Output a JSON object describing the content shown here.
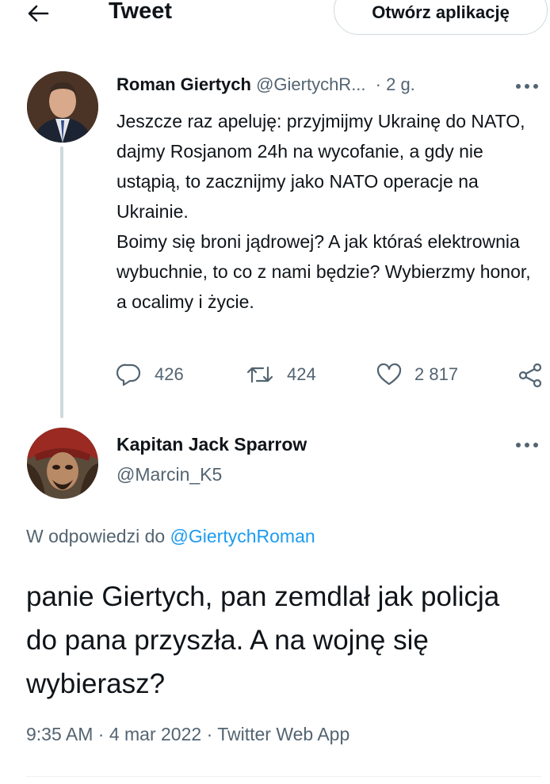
{
  "header": {
    "title": "Tweet",
    "open_app_label": "Otwórz aplikację"
  },
  "tweet": {
    "author_name": "Roman Giertych",
    "handle": "@GiertychR...",
    "time": "· 2 g.",
    "text": "Jeszcze raz apeluję: przyjmijmy Ukrainę do NATO, dajmy Rosjanom 24h na wycofanie, a gdy nie ustąpią, to zacznijmy jako NATO operacje na Ukrainie.\nBoimy się broni jądrowej? A jak któraś elektrownia wybuchnie, to co z nami będzie? Wybierzmy honor, a ocalimy i życie.",
    "actions": {
      "replies": "426",
      "retweets": "424",
      "likes": "2 817"
    }
  },
  "reply": {
    "author_name": "Kapitan Jack Sparrow",
    "handle": "@Marcin_K5",
    "in_reply_prefix": "W odpowiedzi do",
    "in_reply_handle": "@GiertychRoman",
    "text": "panie Giertych, pan zemdlał jak policja do pana przyszła. A na wojnę się wybierasz?",
    "timestamp": "9:35 AM · 4 mar 2022 · Twitter Web App"
  },
  "colors": {
    "text": "#0f1419",
    "secondary": "#536471",
    "link": "#1d9bf0",
    "border": "#cfd9de"
  },
  "icons": [
    "back-arrow-icon",
    "more-icon",
    "reply-icon",
    "retweet-icon",
    "like-icon",
    "share-icon"
  ]
}
